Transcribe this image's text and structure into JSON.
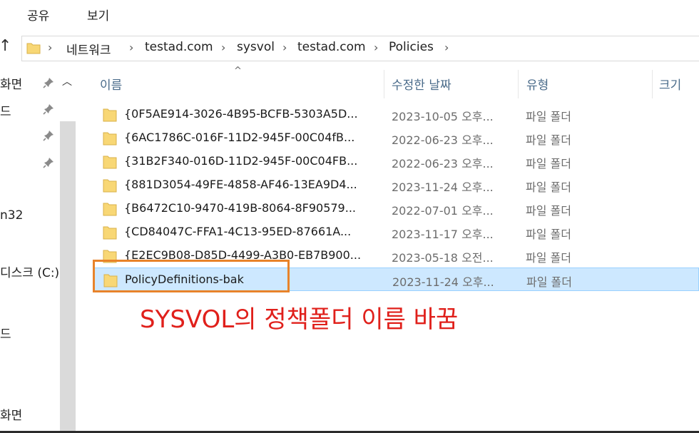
{
  "ribbon": {
    "tabs": [
      "공유",
      "보기"
    ]
  },
  "address": {
    "crumbs": [
      "네트워크",
      "testad.com",
      "sysvol",
      "testad.com",
      "Policies"
    ]
  },
  "nav": {
    "items": [
      "화면",
      "드",
      "n32",
      "디스크 (C:)",
      "드",
      "화면"
    ]
  },
  "columns": {
    "name": "이름",
    "date": "수정한 날짜",
    "type": "유형",
    "size": "크기"
  },
  "rows": [
    {
      "name": "{0F5AE914-3026-4B95-BCFB-5303A5D...",
      "date": "2023-10-05 오후...",
      "type": "파일 폴더"
    },
    {
      "name": "{6AC1786C-016F-11D2-945F-00C04fB...",
      "date": "2022-06-23 오후...",
      "type": "파일 폴더"
    },
    {
      "name": "{31B2F340-016D-11D2-945F-00C04FB...",
      "date": "2022-06-23 오후...",
      "type": "파일 폴더"
    },
    {
      "name": "{881D3054-49FE-4858-AF46-13EA9D4...",
      "date": "2023-11-24 오후...",
      "type": "파일 폴더"
    },
    {
      "name": "{B6472C10-9470-419B-8064-8F90579...",
      "date": "2022-07-01 오후...",
      "type": "파일 폴더"
    },
    {
      "name": "{CD84047C-FFA1-4C13-95ED-87661A...",
      "date": "2023-11-17 오후...",
      "type": "파일 폴더"
    },
    {
      "name": "{E2EC9B08-D85D-4499-A3B0-EB7B900...",
      "date": "2023-05-18 오전...",
      "type": "파일 폴더"
    },
    {
      "name": "PolicyDefinitions-bak",
      "date": "2023-11-24 오후...",
      "type": "파일 폴더"
    }
  ],
  "annotation": "SYSVOL의 정책폴더 이름 바꿈",
  "colors": {
    "selection": "#cde8ff",
    "highlight_box": "#e8832a",
    "annotation": "#e0201b",
    "folder": "#f8d775"
  }
}
